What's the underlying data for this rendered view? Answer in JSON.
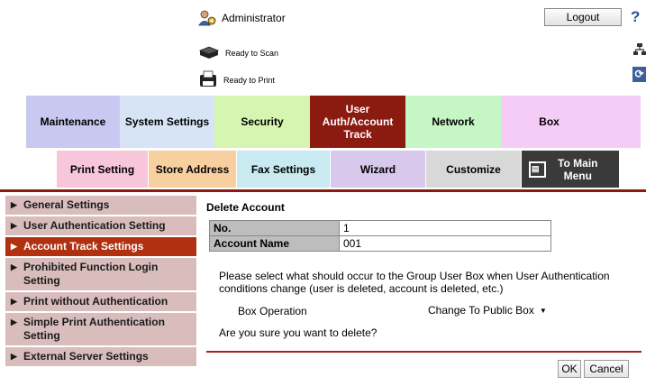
{
  "header": {
    "user": "Administrator",
    "user_icon": "administrator-icon",
    "logout_label": "Logout",
    "help_label": "?",
    "scan_status": "Ready to Scan",
    "print_status": "Ready to Print"
  },
  "main_tabs": [
    {
      "label": "Maintenance",
      "color": "#c8c8f0",
      "active": false
    },
    {
      "label": "System Settings",
      "color": "#d6e4f5",
      "active": false
    },
    {
      "label": "Security",
      "color": "#d6f5b0",
      "active": false
    },
    {
      "label": "User Auth/Account Track",
      "color": "#8b1a10",
      "active": true
    },
    {
      "label": "Network",
      "color": "#c6f5c6",
      "active": false
    },
    {
      "label": "Box",
      "color": "#f5ccf5",
      "active": false
    }
  ],
  "sub_tabs": [
    {
      "label": "Print Setting",
      "color": "#f7c6da"
    },
    {
      "label": "Store Address",
      "color": "#f8d0a0"
    },
    {
      "label": "Fax Settings",
      "color": "#c8eaf0"
    },
    {
      "label": "Wizard",
      "color": "#d8c8ec"
    },
    {
      "label": "Customize",
      "color": "#d8d8d8"
    }
  ],
  "to_main_menu": {
    "label": "To Main Menu",
    "icon": "main-menu-icon",
    "color": "#3a3a3a"
  },
  "sidebar": {
    "items": [
      {
        "label": "General Settings"
      },
      {
        "label": "User Authentication Setting"
      },
      {
        "label": "Account Track Settings"
      },
      {
        "label": "Prohibited Function Login Setting"
      },
      {
        "label": "Print without Authentication"
      },
      {
        "label": "Simple Print Authentication Setting"
      },
      {
        "label": "External Server Settings"
      }
    ],
    "active_index": 2
  },
  "content": {
    "title": "Delete Account",
    "table": [
      {
        "label": "No.",
        "value": "1"
      },
      {
        "label": "Account Name",
        "value": "001"
      }
    ],
    "description": "Please select what should occur to the Group User Box when User Authentication conditions change (user is deleted, account is deleted, etc.)",
    "box_operation_label": "Box Operation",
    "box_operation_value": "Change To Public Box",
    "confirm_text": "Are you sure you want to delete?",
    "ok_label": "OK",
    "cancel_label": "Cancel"
  },
  "colors": {
    "accent": "#8b1a10",
    "sidebar_bg": "#d9bcbc",
    "sidebar_active": "#b03010"
  }
}
